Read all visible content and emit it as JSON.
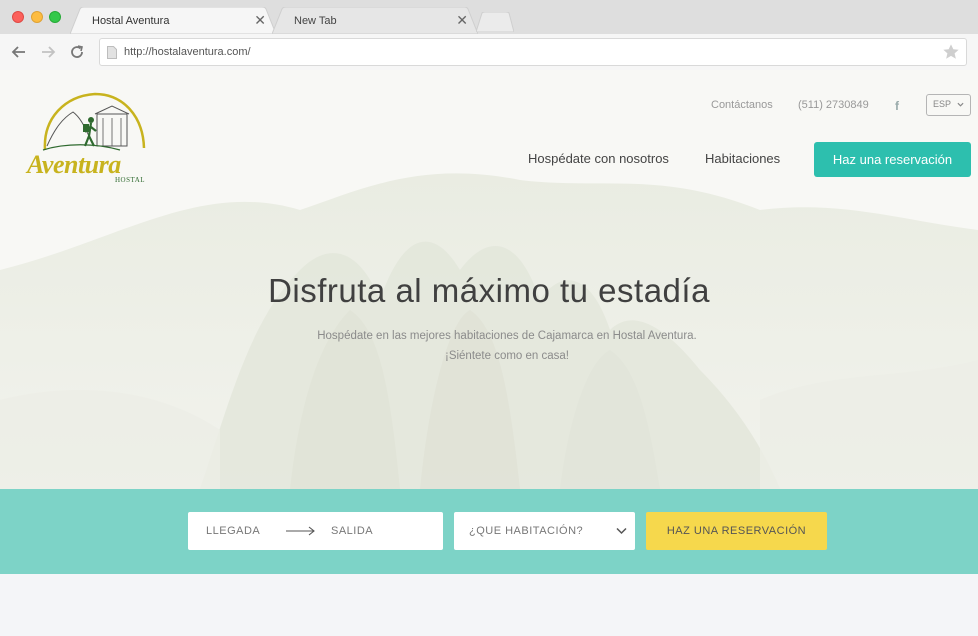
{
  "browser": {
    "tabs": [
      {
        "label": "Hostal Aventura",
        "active": true
      },
      {
        "label": "New Tab",
        "active": false
      }
    ],
    "url": "http://hostalaventura.com/",
    "icons": [
      "back-arrow-icon",
      "forward-arrow-icon",
      "reload-icon",
      "page-icon",
      "bookmark-star-icon",
      "tab-close-icon"
    ]
  },
  "header": {
    "logo": {
      "brand": "Aventura",
      "tagline": "HOSTAL"
    },
    "contact_label": "Contáctanos",
    "phone": "(511) 2730849",
    "social_icon": "facebook-icon",
    "language": "ESP",
    "nav": {
      "stay": "Hospédate con nosotros",
      "rooms": "Habitaciones",
      "cta": "Haz una reservación"
    }
  },
  "hero": {
    "title": "Disfruta al máximo tu estadía",
    "subtitle_line1": "Hospédate en las mejores habitaciones de Cajamarca en Hostal Aventura.",
    "subtitle_line2": "¡Siéntete como en casa!"
  },
  "booking": {
    "arrival": "LLEGADA",
    "departure": "SALIDA",
    "room_select": "¿QUE HABITACIÓN?",
    "submit": "HAZ UNA RESERVACIÓN"
  },
  "colors": {
    "accent_teal": "#2dbfae",
    "booking_strip": "#7dd3c7",
    "booking_button": "#f6d84c",
    "logo_yellow": "#c8b31e",
    "logo_green": "#2f6a2f"
  }
}
